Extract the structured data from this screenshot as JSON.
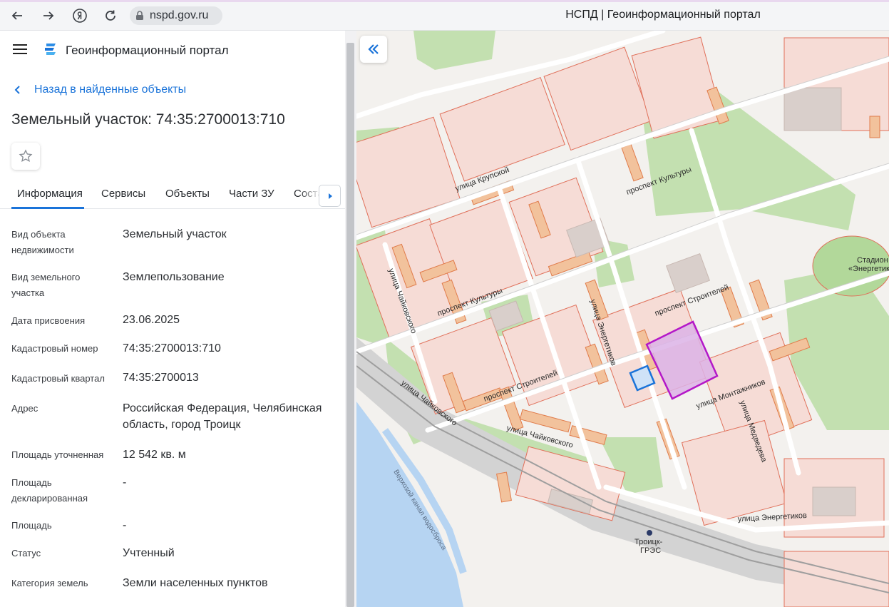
{
  "browser": {
    "url": "nspd.gov.ru",
    "page_title": "НСПД | Геоинформационный портал"
  },
  "header": {
    "app_title": "Геоинформационный портал"
  },
  "back_link": "Назад в найденные объекты",
  "object_title": "Земельный участок: 74:35:2700013:710",
  "tabs": [
    {
      "label": "Информация",
      "active": true
    },
    {
      "label": "Сервисы"
    },
    {
      "label": "Объекты"
    },
    {
      "label": "Части ЗУ"
    },
    {
      "label": "Соста"
    }
  ],
  "properties": [
    {
      "label": "Вид объекта недвижимости",
      "value": "Земельный участок"
    },
    {
      "label": "Вид земельного участка",
      "value": "Землепользование"
    },
    {
      "label": "Дата присвоения",
      "value": "23.06.2025"
    },
    {
      "label": "Кадастровый номер",
      "value": "74:35:2700013:710"
    },
    {
      "label": "Кадастровый квартал",
      "value": "74:35:2700013"
    },
    {
      "label": "Адрес",
      "value": "Российская Федерация, Челябинская область, город Троицк"
    },
    {
      "label": "Площадь уточненная",
      "value": "12 542 кв. м"
    },
    {
      "label": "Площадь декларированная",
      "value": "-"
    },
    {
      "label": "Площадь",
      "value": "-"
    },
    {
      "label": "Статус",
      "value": "Учтенный"
    },
    {
      "label": "Категория земель",
      "value": "Земли населенных пунктов"
    }
  ],
  "map": {
    "street_labels": {
      "krupskoy": "улица Крупской",
      "kultury_1": "проспект Культуры",
      "kultury_2": "проспект Культуры",
      "stroiteley_1": "проспект Строителей",
      "stroiteley_2": "проспект Строителей",
      "chaykovskogo_1": "улица Чайковского",
      "chaykovskogo_2": "улица Чайковского",
      "chaykovskogo_3": "улица Чайковского",
      "energetikov_1": "улица Энергетиков",
      "energetikov_2": "улица Энергетиков",
      "montazhnikov": "улица Монтажников",
      "medvedeva": "улица Медведева",
      "canal": "Верхозой канал водосброса"
    },
    "stadium_line1": "Стадион",
    "stadium_line2": "«Энергетик»",
    "station_line1": "Троицк-",
    "station_line2": "ГРЭС",
    "colors": {
      "selected_parcel": "#b418c8",
      "highlighted_parcel": "#1a73d9",
      "parcel_border": "#e0705a",
      "green": "#c3e0b0",
      "water": "#b6d4f2"
    }
  }
}
